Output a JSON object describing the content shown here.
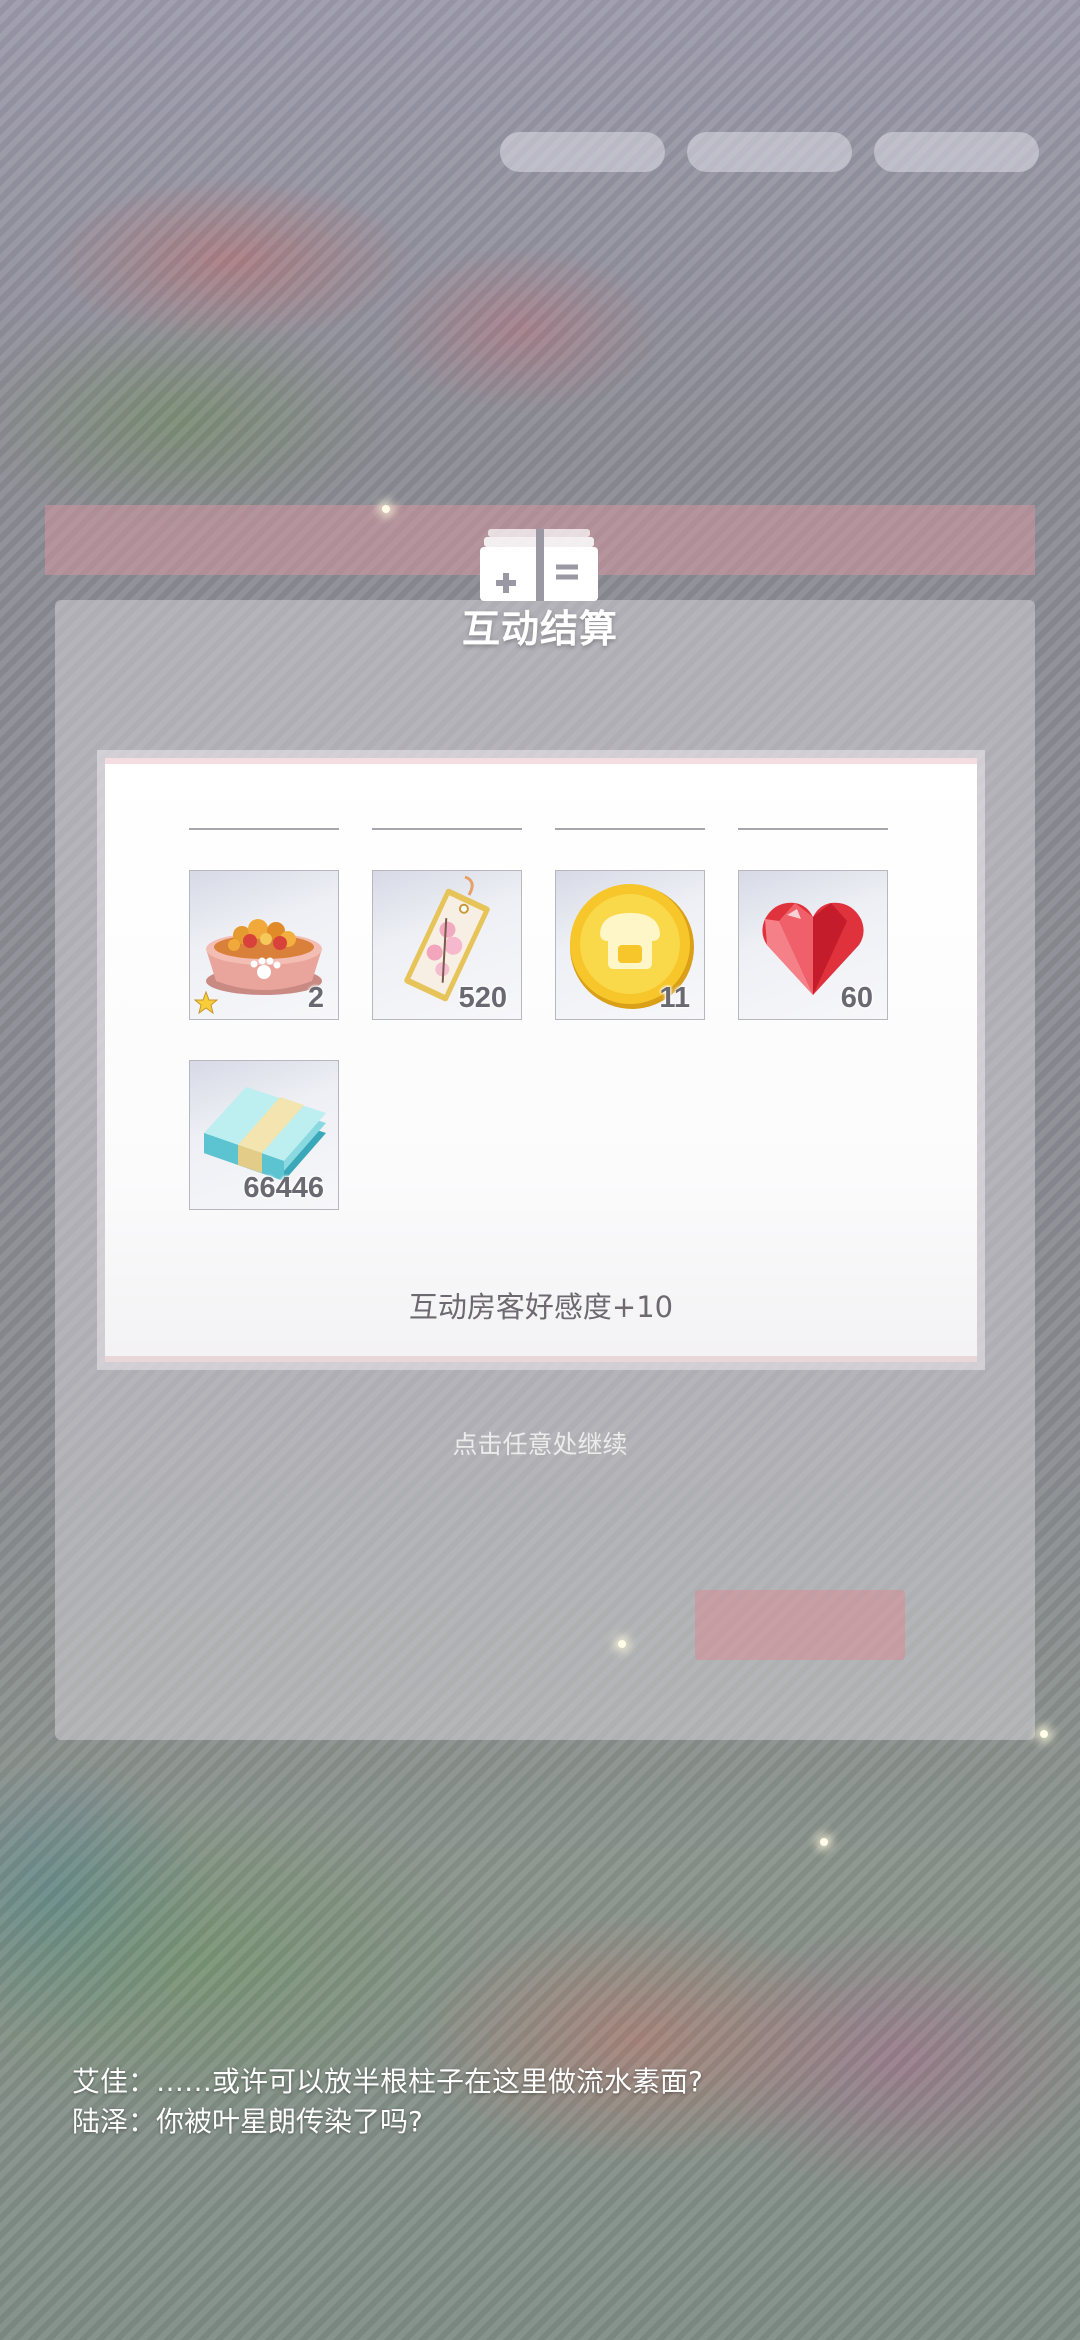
{
  "result": {
    "title": "互动结算",
    "items": [
      {
        "icon": "pet-food-bowl-icon",
        "count": "2",
        "starred": true
      },
      {
        "icon": "sakura-bookmark-icon",
        "count": "520",
        "starred": false
      },
      {
        "icon": "gold-coin-icon",
        "count": "11",
        "starred": false
      },
      {
        "icon": "red-heart-gem-icon",
        "count": "60",
        "starred": false
      },
      {
        "icon": "cash-bundle-icon",
        "count": "66446",
        "starred": false
      }
    ],
    "affinity_text": "互动房客好感度+10"
  },
  "continue_hint": "点击任意处继续",
  "dialog": {
    "line1": "艾佳：……或许可以放半根柱子在这里做流水素面?",
    "line2": "陆泽：你被叶星朗传染了吗?"
  },
  "colors": {
    "title_text": "#ffffff",
    "panel_border": "#f3dde0",
    "count_text": "#6a6870"
  }
}
